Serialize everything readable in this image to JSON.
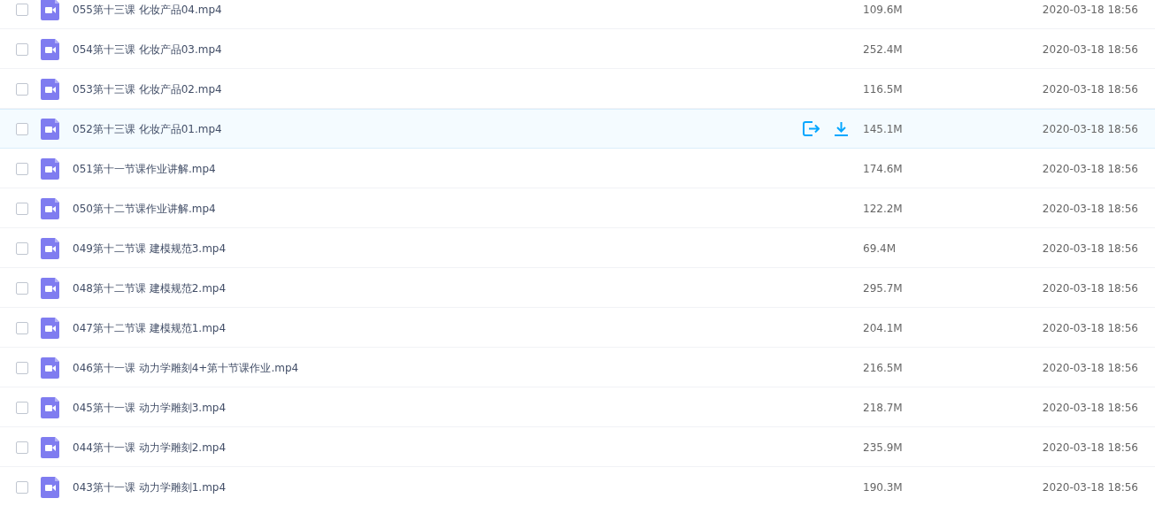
{
  "files": [
    {
      "name": "055第十三课 化妆产品04.mp4",
      "size": "109.6M",
      "date": "2020-03-18 18:56",
      "checked": false,
      "hovered": false
    },
    {
      "name": "054第十三课 化妆产品03.mp4",
      "size": "252.4M",
      "date": "2020-03-18 18:56",
      "checked": false,
      "hovered": false
    },
    {
      "name": "053第十三课 化妆产品02.mp4",
      "size": "116.5M",
      "date": "2020-03-18 18:56",
      "checked": false,
      "hovered": false
    },
    {
      "name": "052第十三课 化妆产品01.mp4",
      "size": "145.1M",
      "date": "2020-03-18 18:56",
      "checked": false,
      "hovered": true
    },
    {
      "name": "051第十一节课作业讲解.mp4",
      "size": "174.6M",
      "date": "2020-03-18 18:56",
      "checked": false,
      "hovered": false
    },
    {
      "name": "050第十二节课作业讲解.mp4",
      "size": "122.2M",
      "date": "2020-03-18 18:56",
      "checked": false,
      "hovered": false
    },
    {
      "name": "049第十二节课 建模规范3.mp4",
      "size": "69.4M",
      "date": "2020-03-18 18:56",
      "checked": false,
      "hovered": false
    },
    {
      "name": "048第十二节课 建模规范2.mp4",
      "size": "295.7M",
      "date": "2020-03-18 18:56",
      "checked": false,
      "hovered": false
    },
    {
      "name": "047第十二节课 建模规范1.mp4",
      "size": "204.1M",
      "date": "2020-03-18 18:56",
      "checked": false,
      "hovered": false
    },
    {
      "name": "046第十一课 动力学雕刻4+第十节课作业.mp4",
      "size": "216.5M",
      "date": "2020-03-18 18:56",
      "checked": false,
      "hovered": false
    },
    {
      "name": "045第十一课 动力学雕刻3.mp4",
      "size": "218.7M",
      "date": "2020-03-18 18:56",
      "checked": false,
      "hovered": false
    },
    {
      "name": "044第十一课 动力学雕刻2.mp4",
      "size": "235.9M",
      "date": "2020-03-18 18:56",
      "checked": false,
      "hovered": false
    },
    {
      "name": "043第十一课 动力学雕刻1.mp4",
      "size": "190.3M",
      "date": "2020-03-18 18:56",
      "checked": false,
      "hovered": false
    }
  ]
}
